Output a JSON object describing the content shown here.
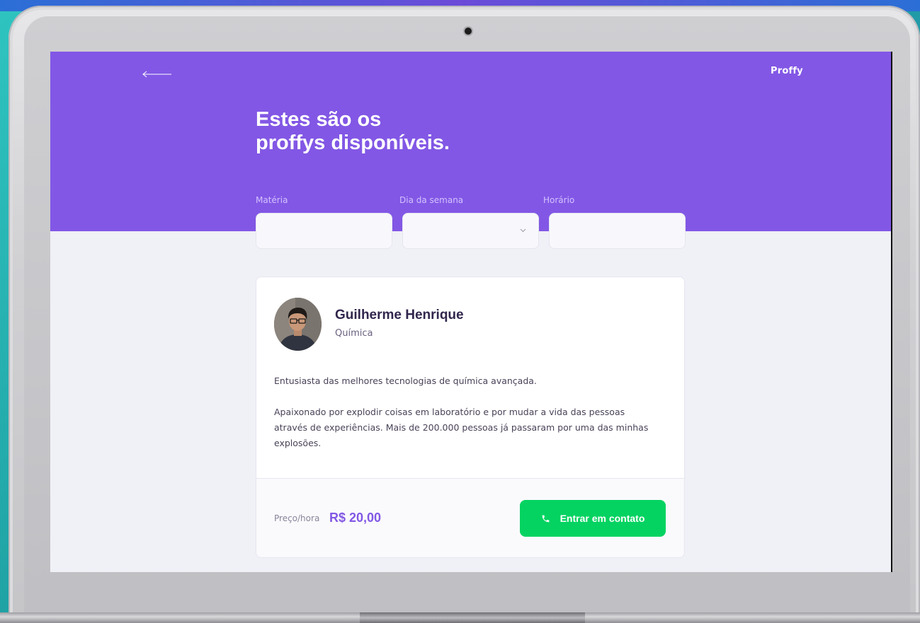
{
  "brand": "Proffy",
  "title": {
    "line1": "Estes são os",
    "line2": "proffys disponíveis."
  },
  "filters": {
    "subject_label": "Matéria",
    "subject_value": "",
    "weekday_label": "Dia da semana",
    "weekday_value": "",
    "time_label": "Horário",
    "time_value": ""
  },
  "teacher": {
    "name": "Guilherme Henrique",
    "subject": "Química",
    "bio_paragraphs": [
      "Entusiasta das melhores tecnologias de química avançada.",
      "Apaixonado por explodir coisas em laboratório e por mudar a vida das pessoas através de experiências. Mais de 200.000 pessoas já passaram por uma das minhas explosões."
    ],
    "price_label": "Preço/hora",
    "price_value": "R$ 20,00",
    "contact_label": "Entrar em contato"
  },
  "icons": {
    "back": "arrow-left-icon",
    "select": "chevron-down-icon",
    "contact": "whatsapp-icon"
  },
  "colors": {
    "primary": "#8257e5",
    "success": "#04d361",
    "background": "#f0f0f7",
    "title_text": "#32264d"
  }
}
